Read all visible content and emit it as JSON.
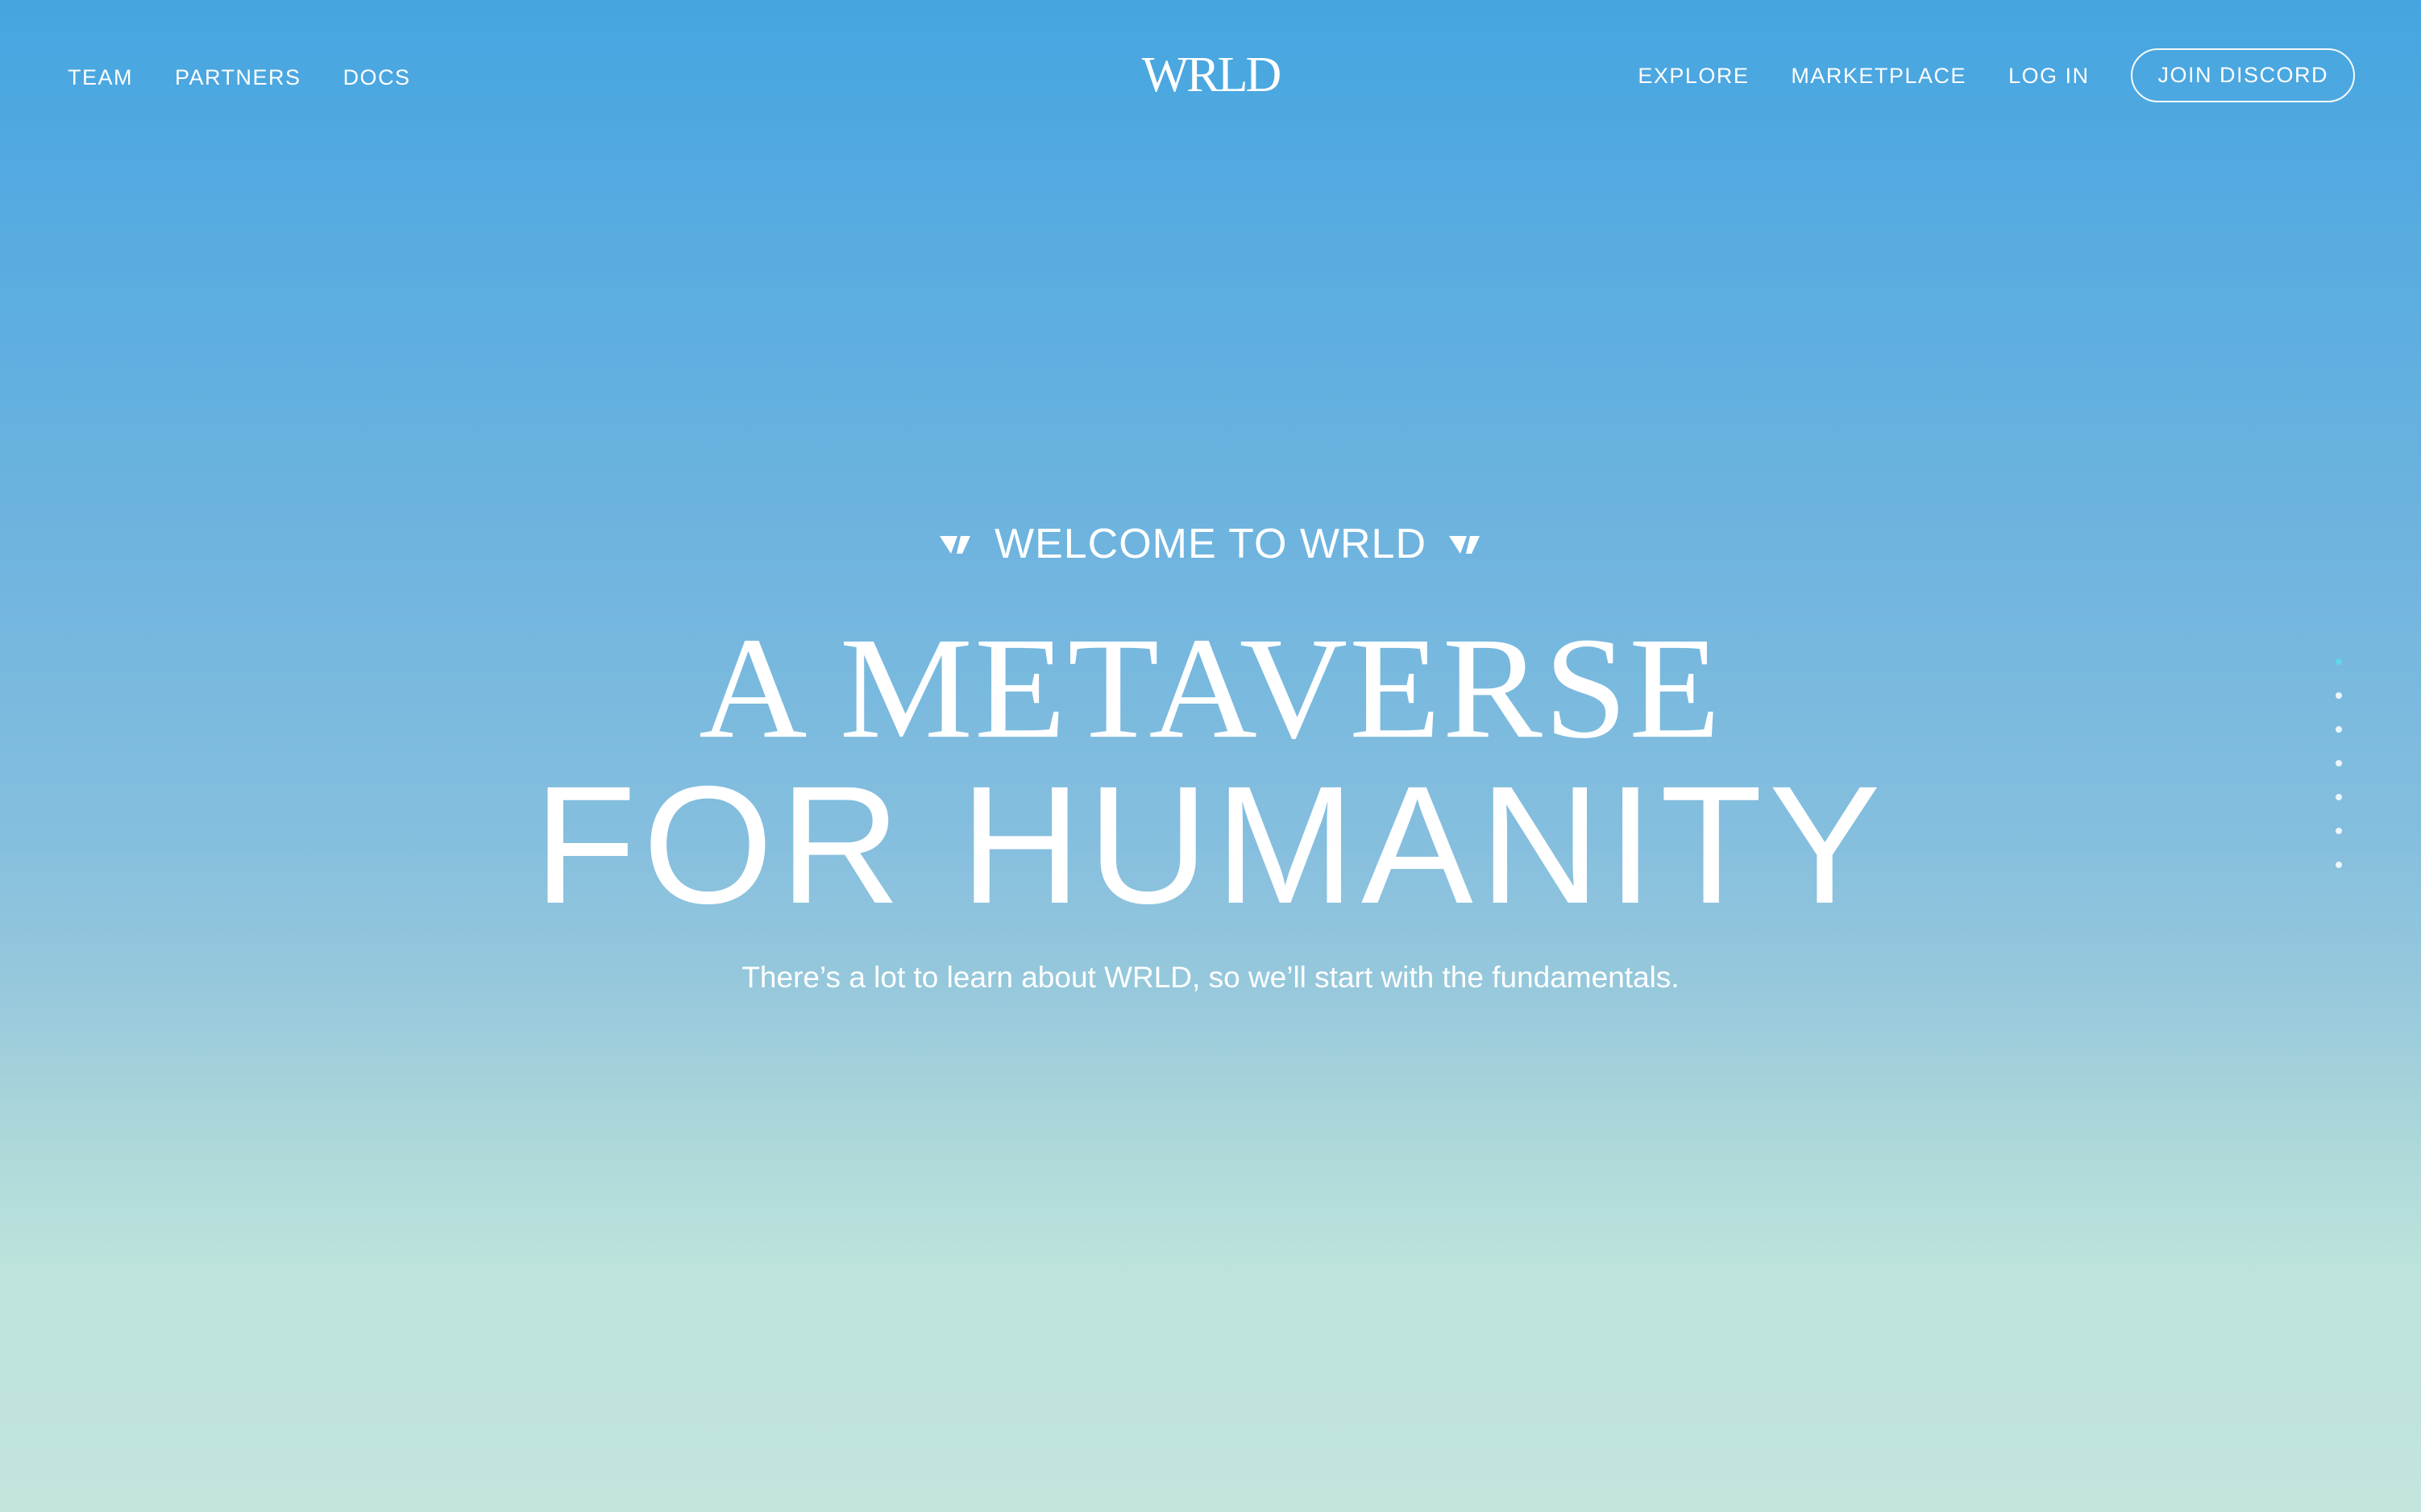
{
  "header": {
    "nav_left": [
      {
        "label": "TEAM"
      },
      {
        "label": "PARTNERS"
      },
      {
        "label": "DOCS"
      }
    ],
    "logo_text": "WRLD",
    "nav_right": [
      {
        "label": "EXPLORE"
      },
      {
        "label": "MARKETPLACE"
      },
      {
        "label": "LOG IN"
      }
    ],
    "cta_label": "JOIN DISCORD"
  },
  "hero": {
    "eyebrow": "WELCOME TO WRLD",
    "eyebrow_icon": "wrld-mark-icon",
    "headline_line1": "A METAVERSE",
    "headline_line2": "FOR HUMANITY",
    "subtitle": "There’s a lot to learn about WRLD, so we’ll start with the fundamentals."
  },
  "pagination": {
    "total": 7,
    "active_index": 0,
    "active_color": "#62d6ee",
    "inactive_color": "#ffffff"
  },
  "colors": {
    "gradient_top": "#45a5e0",
    "gradient_bottom": "#c2e5de",
    "text": "#ffffff"
  }
}
